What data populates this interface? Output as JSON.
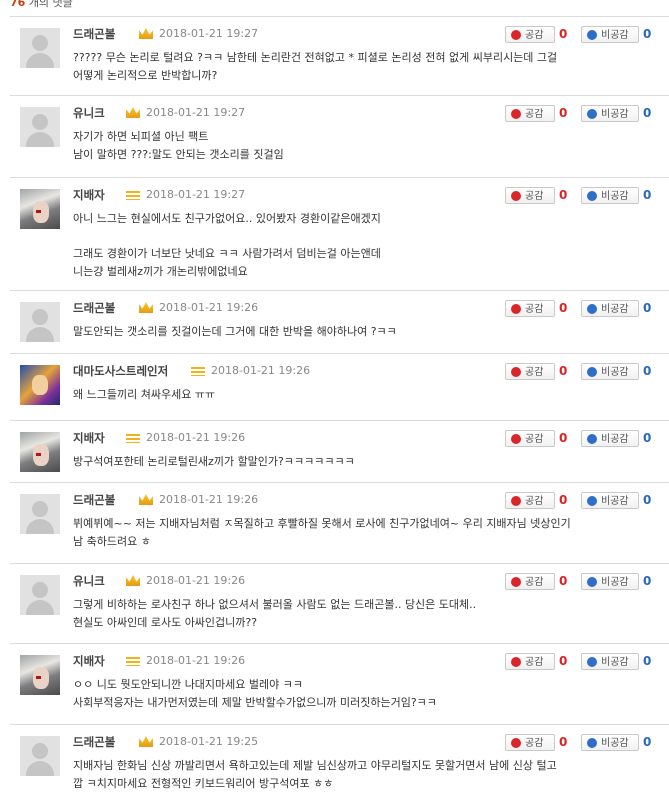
{
  "header": {
    "count": "76",
    "label": "개의 댓글"
  },
  "vote_labels": {
    "up": "공감",
    "down": "비공감"
  },
  "comments": [
    {
      "nick": "드래곤볼",
      "badge": "crown-icon",
      "date": "2018-01-21 19:27",
      "up": "0",
      "down": "0",
      "text": "????? 무슨 논리로 털려요 ?ㅋㅋ 남한테 논리란건 전혀없고 * 피셜로 논리성 전혀 없게 씨부리시는데 그걸\n어떻게 논리적으로 반박합니까?"
    },
    {
      "nick": "유니크",
      "badge": "crown-icon",
      "date": "2018-01-21 19:27",
      "up": "0",
      "down": "0",
      "text": "자기가 하면 뇌피셜 아닌 팩트\n남이 말하면 ???:말도 안되는 갯소리를 짓걸임"
    },
    {
      "nick": "지배자",
      "badge": "bars-icon",
      "date": "2018-01-21 19:27",
      "up": "0",
      "down": "0",
      "text": "아니 느그는 현실에서도 친구가없어요.. 있어봤자 경환이같은애겠지\n\n그래도 경환이가 너보단 낫네요 ㅋㅋ 사람가려서 덤비는걸 아는앤데\n니는걍 벌레새z끼가 개논리밖에없네요"
    },
    {
      "nick": "드래곤볼",
      "badge": "crown-icon",
      "date": "2018-01-21 19:26",
      "up": "0",
      "down": "0",
      "text": "말도안되는 갯소리를 짓걸이는데 그거에 대한 반박을 해야하나여 ?ㅋㅋ"
    },
    {
      "nick": "대마도사스트레인저",
      "badge": "bars-icon",
      "date": "2018-01-21 19:26",
      "up": "0",
      "down": "0",
      "text": "왜 느그들끼리 쳐싸우세요 ㅠㅠ"
    },
    {
      "nick": "지배자",
      "badge": "bars-icon",
      "date": "2018-01-21 19:26",
      "up": "0",
      "down": "0",
      "text": "방구석여포한테 논리로털린새z끼가 할말인가?ㅋㅋㅋㅋㅋㅋㅋ"
    },
    {
      "nick": "드래곤볼",
      "badge": "crown-icon",
      "date": "2018-01-21 19:26",
      "up": "0",
      "down": "0",
      "text": "뷔예뷔예~~ 저는 지배자님처럼 ㅈ목질하고 후빨하질 못해서 로사에 친구가없네여~ 우리 지배자님 넷상인기\n남 축하드려요 ㅎ"
    },
    {
      "nick": "유니크",
      "badge": "crown-icon",
      "date": "2018-01-21 19:26",
      "up": "0",
      "down": "0",
      "text": "그렇게 비하하는 로사친구 하나 없으셔서 불러올 사람도 없는 드래곤볼.. 당신은 도대체..\n현실도 아싸인데 로사도 아싸인겁니까??"
    },
    {
      "nick": "지배자",
      "badge": "bars-icon",
      "date": "2018-01-21 19:26",
      "up": "0",
      "down": "0",
      "text": "ㅇㅇ 니도 뭣도안되니깐 나대지마세요 벌레야 ㅋㅋ\n사회부적응자는 내가먼저였는데 제말 반박할수가없으니까 미러짓하는거임?ㅋㅋ"
    },
    {
      "nick": "드래곤볼",
      "badge": "crown-icon",
      "date": "2018-01-21 19:25",
      "up": "0",
      "down": "0",
      "text": "지배자님 한화님 신상 까발리면서 욕하고있는데 제발 님신상까고 야무리털지도 못할거면서 남에 신상 털고\n깝 ㅋ치지마세요 전형적인 키보드워리어 방구석여포 ㅎㅎ"
    }
  ]
}
